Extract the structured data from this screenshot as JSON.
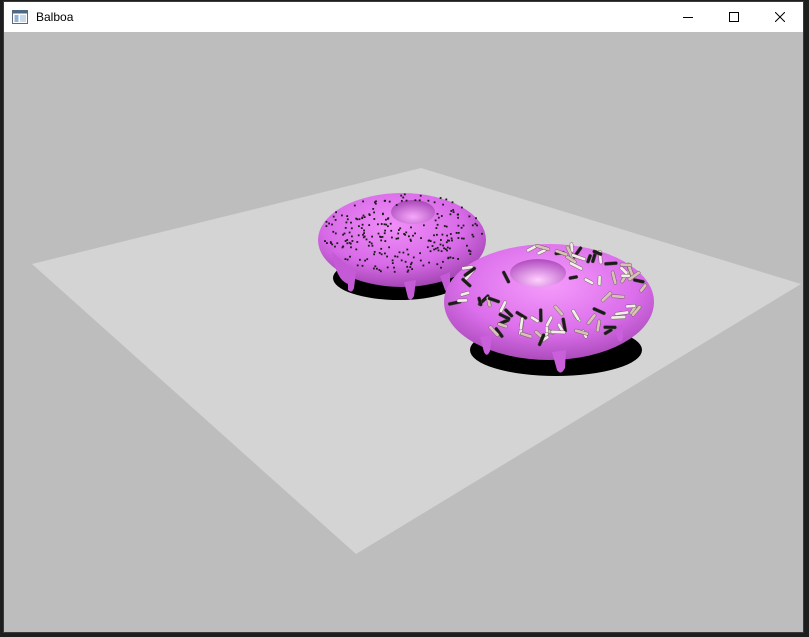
{
  "window": {
    "title": "Balboa",
    "app_icon": "window-app-icon",
    "controls": {
      "minimize_icon": "minimize-icon",
      "maximize_icon": "maximize-icon",
      "close_icon": "close-icon"
    }
  },
  "scene": {
    "background_color": "#bdbdbd",
    "floor_color": "#d4d4d4",
    "frosting_color": "#d86ae8",
    "shadow_color": "#000000",
    "objects": [
      "donut-chocolate-sprinkles",
      "donut-rainbow-sprinkles"
    ]
  }
}
